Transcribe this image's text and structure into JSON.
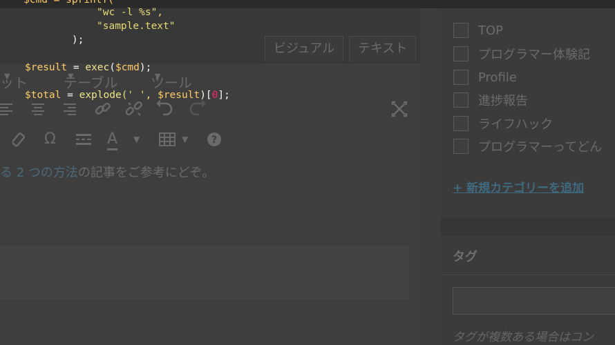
{
  "editor": {
    "tabs": {
      "visual": "ビジュアル",
      "text": "テキスト"
    },
    "menus": [
      {
        "label": "ット"
      },
      {
        "label": "テーブル"
      },
      {
        "label": "ツール"
      }
    ],
    "toolbar1_icons": [
      "align-left-icon",
      "align-center-icon",
      "align-right-icon",
      "link-icon",
      "unlink-icon",
      "undo-icon",
      "redo-icon",
      "fullscreen-icon"
    ],
    "toolbar2": {
      "omega": "Ω",
      "text_color": "A",
      "help": "?"
    },
    "content": {
      "link_text": "る 2 つの方法",
      "rest_text": "の記事をご参考にどぞ。"
    }
  },
  "sidebar": {
    "categories": [
      {
        "label": "TOP"
      },
      {
        "label": "プログラマー体験記"
      },
      {
        "label": "Profile"
      },
      {
        "label": "進捗報告"
      },
      {
        "label": "ライフハック"
      },
      {
        "label": "プログラマーってどん"
      }
    ],
    "add_category": "+ 新規カテゴリーを追加",
    "tags_title": "タグ",
    "tags_hint": "タグが複数ある場合はコン"
  },
  "code": {
    "line_top": "$cmd = sprintf(",
    "arg1": "\"wc -l %s\",",
    "arg2": "\"sample.text\"",
    "close": ");",
    "result_var": "$result",
    "result_eq": " = ",
    "result_fn": "exec",
    "result_open": "(",
    "result_arg": "$cmd",
    "result_close": ");",
    "total_var": "$total",
    "total_eq": " = ",
    "total_fn": "explode",
    "total_args": "(' ', ",
    "total_arg2": "$result",
    "total_close": ")[",
    "total_idx": "0",
    "total_end": "];"
  },
  "colors": {
    "string": "#e6db74",
    "variable": "#ffcc66",
    "number": "#f92672",
    "link": "#3f6a7f"
  }
}
